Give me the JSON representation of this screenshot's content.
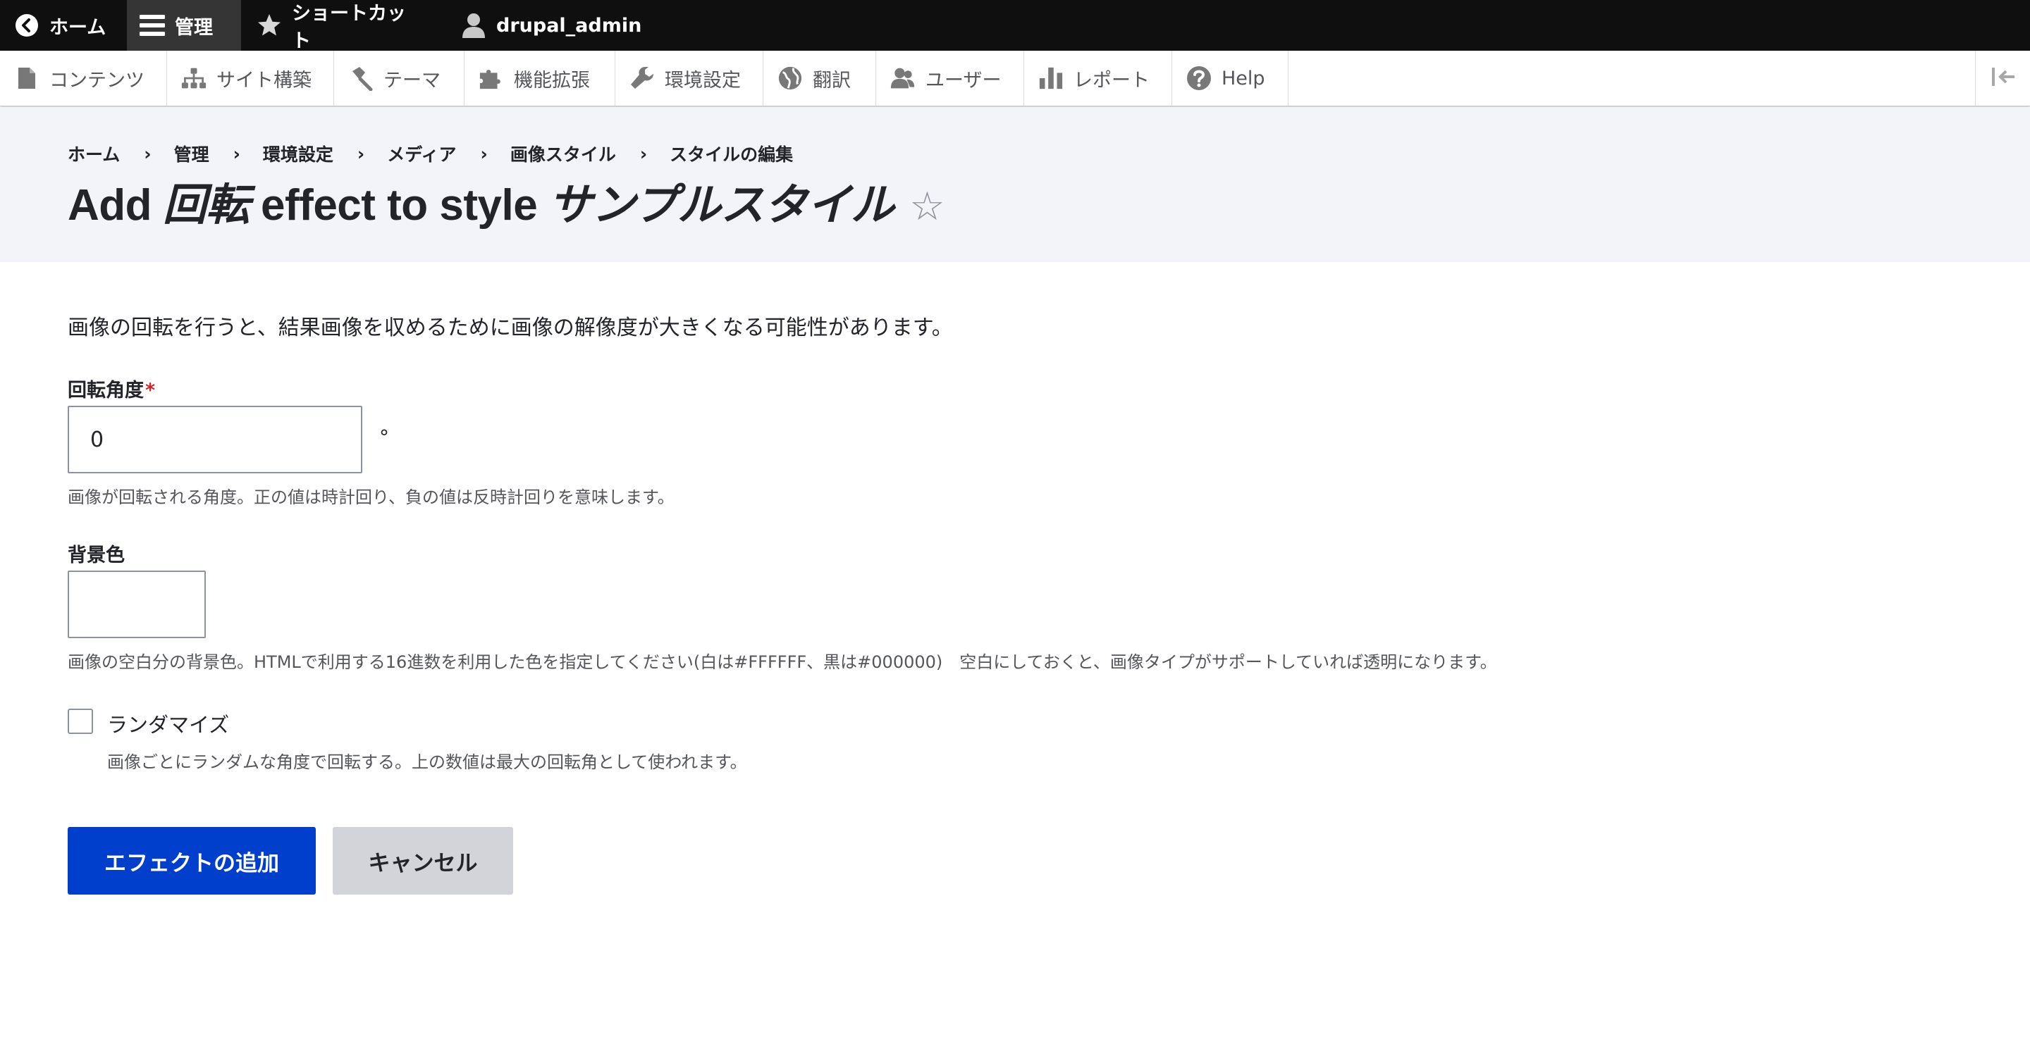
{
  "toolbar": {
    "home": "ホーム",
    "manage": "管理",
    "shortcuts": "ショートカット",
    "user": "drupal_admin"
  },
  "tray": {
    "items": [
      {
        "label": "コンテンツ",
        "icon": "file-icon"
      },
      {
        "label": "サイト構築",
        "icon": "sitemap-icon"
      },
      {
        "label": "テーマ",
        "icon": "paintbrush-icon"
      },
      {
        "label": "機能拡張",
        "icon": "puzzle-icon"
      },
      {
        "label": "環境設定",
        "icon": "wrench-icon"
      },
      {
        "label": "翻訳",
        "icon": "globe-icon"
      },
      {
        "label": "ユーザー",
        "icon": "people-icon"
      },
      {
        "label": "レポート",
        "icon": "bar-chart-icon"
      },
      {
        "label": "Help",
        "icon": "help-icon"
      }
    ]
  },
  "breadcrumb": [
    "ホーム",
    "管理",
    "環境設定",
    "メディア",
    "画像スタイル",
    "スタイルの編集"
  ],
  "breadcrumb_separator": "›",
  "title": {
    "prefix": "Add",
    "effect": "回転",
    "middle": "effect to style",
    "style": "サンプルスタイル",
    "star": "☆"
  },
  "form": {
    "intro": "画像の回転を行うと、結果画像を収めるために画像の解像度が大きくなる可能性があります。",
    "angle": {
      "label": "回転角度",
      "required_mark": "*",
      "value": "0",
      "unit": "°",
      "description": "画像が回転される角度。正の値は時計回り、負の値は反時計回りを意味します。"
    },
    "bgcolor": {
      "label": "背景色",
      "value": "",
      "description": "画像の空白分の背景色。HTMLで利用する16進数を利用した色を指定してください(白は#FFFFFF、黒は#000000)　空白にしておくと、画像タイプがサポートしていれば透明になります。"
    },
    "random": {
      "label": "ランダマイズ",
      "checked": false,
      "description": "画像ごとにランダムな角度で回転する。上の数値は最大の回転角として使われます。"
    },
    "submit_label": "エフェクトの追加",
    "cancel_label": "キャンセル"
  },
  "colors": {
    "toolbar_bg": "#0f0f0f",
    "primary": "#003ecc",
    "required": "#d72222",
    "header_bg": "#f3f4f9"
  }
}
